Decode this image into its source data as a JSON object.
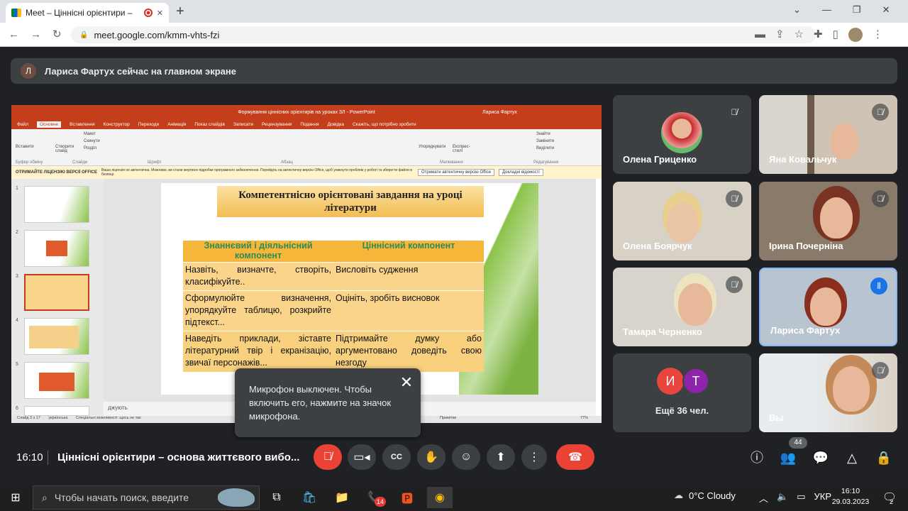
{
  "browser": {
    "tab_title": "Meet – Ціннісні орієнтири – ",
    "new_tab": "+",
    "url": "meet.google.com/kmm-vhts-fzi"
  },
  "banner": {
    "avatar_letter": "Л",
    "text": "Лариса Фартух сейчас на главном экране"
  },
  "presentation": {
    "window_title": "Формування ціннісних орієнтирів на уроках ЗЛ  -  PowerPoint",
    "user": "Лариса Фартух",
    "tabs": [
      "Файл",
      "Основне",
      "Вставлення",
      "Конструктор",
      "Переходи",
      "Анімація",
      "Показ слайдів",
      "Записати",
      "Рецензування",
      "Подання",
      "Довідка",
      "Скажіть, що потрібно зробити"
    ],
    "ribbon_groups": [
      "Буфер обміну",
      "Слайди",
      "Шрифт",
      "Абзац",
      "Малювання",
      "Редагування"
    ],
    "ribbon_buttons": [
      "Вставити",
      "Створити слайд",
      "Макет",
      "Скинути",
      "Розділ",
      "Упорядкувати",
      "Експрес-стилі",
      "Знайти",
      "Замінити",
      "Виділити"
    ],
    "warning_title": "ОТРИМАЙТЕ ЛІЦЕНЗІЮ ВЕРСІЇ OFFICE",
    "warning_text": "Ваша ліцензія не автентична. Можливо, ви стали жертвою підробки програмного забезпечення. Перейдіть на автентичну версію Office, щоб уникнути проблем у роботі та зберегти файли в безпеці.",
    "warning_btn1": "Отримати автентичну версію Office",
    "warning_btn2": "Докладні відомості",
    "slide_numbers": [
      "1",
      "2",
      "3",
      "4",
      "5",
      "6"
    ],
    "slide": {
      "title": "Компетентнісно орієнтовані  завдання на уроці літератури",
      "col1_header": "Знаннєвий і діяльнісний компонент",
      "col2_header": "Ціннісний компонент",
      "rows": [
        {
          "left": "Назвіть, визначте, створіть, класифікуйте..",
          "right": "Висловіть судження"
        },
        {
          "left": "Сформулюйте визначення, упорядкуйте таблицю, розкрийте підтекст...",
          "right": "Оцініть, зробіть висновок"
        },
        {
          "left": "Наведіть приклади, зіставте літературний твір і екранізацію, звичаї персонажів...",
          "right": "Підтримайте думку або аргументовано доведіть свою незгоду"
        }
      ]
    },
    "notes": "джують",
    "status_left": "Слайд 3 з 17",
    "status_lang": "українська",
    "status_access": "Спеціальні можливості: щось не так",
    "status_notes": "Примітки",
    "status_zoom": "77%"
  },
  "tooltip": {
    "text": "Микрофон выключен. Чтобы включить его, нажмите на значок микрофона.",
    "close": "✕"
  },
  "participants": [
    {
      "name": "Олена Гриценко",
      "muted": true
    },
    {
      "name": "Яна Ковальчук",
      "muted": true
    },
    {
      "name": "Олена Боярчук",
      "muted": true
    },
    {
      "name": "Ірина Почерніна",
      "muted": true
    },
    {
      "name": "Тамара Черненко",
      "muted": true
    },
    {
      "name": "Лариса Фартух",
      "muted": false
    },
    {
      "name": "Вы",
      "muted": true
    }
  ],
  "more_tile": {
    "avatars": [
      "И",
      "Т"
    ],
    "avatar_colors": [
      "#e8453c",
      "#8e24aa"
    ],
    "text": "Ещё 36 чел."
  },
  "meetbar": {
    "time": "16:10",
    "meeting_name": "Ціннісні орієнтири – основа життєвого вибо...",
    "people_count": "44",
    "end_color": "#ea4335"
  },
  "taskbar": {
    "search_placeholder": "Чтобы начать поиск, введите",
    "weather": "0°C  Cloudy",
    "lang": "УКР",
    "time": "16:10",
    "date": "29.03.2023",
    "viber_badge": "14",
    "notif_count": "2"
  }
}
